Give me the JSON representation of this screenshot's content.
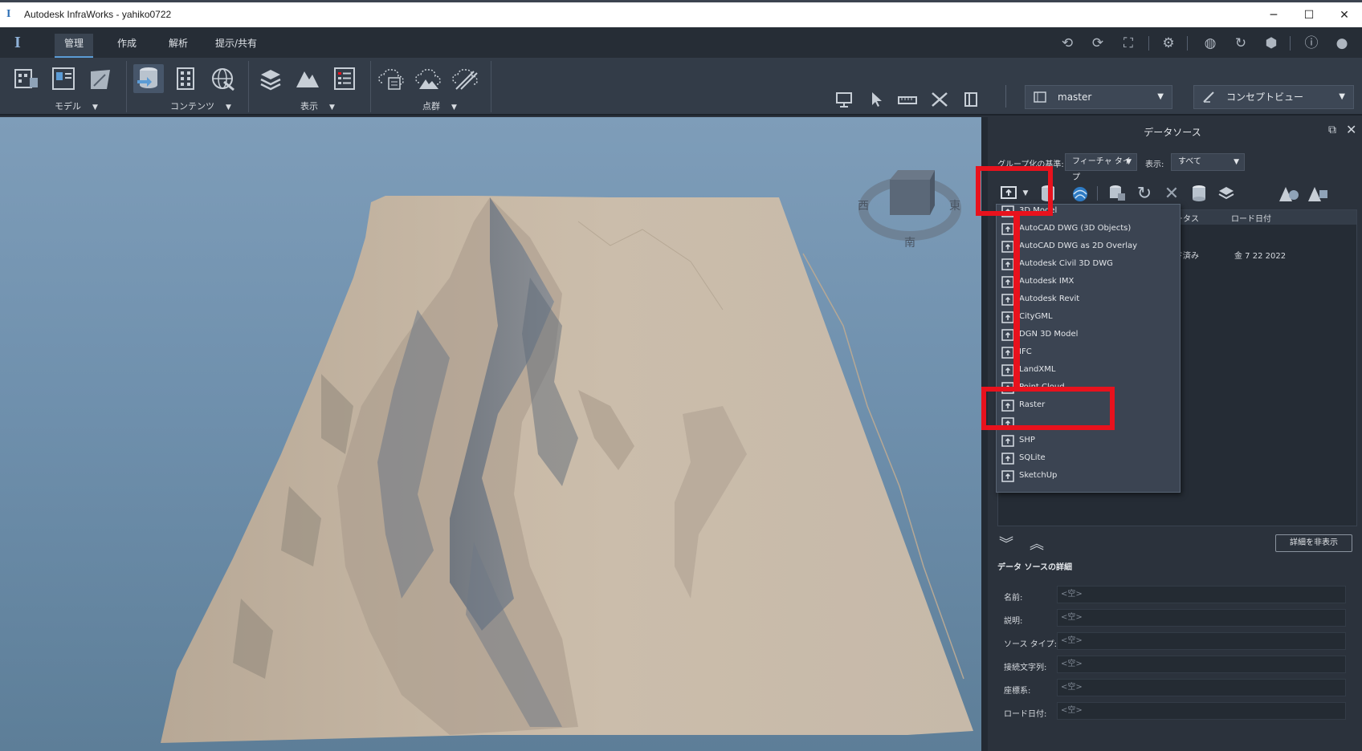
{
  "window": {
    "title": "Autodesk InfraWorks - yahiko0722",
    "controls": [
      "─",
      "☐",
      "✕"
    ]
  },
  "tabs": [
    {
      "label": "管理",
      "active": true
    },
    {
      "label": "作成",
      "active": false
    },
    {
      "label": "解析",
      "active": false
    },
    {
      "label": "提示/共有",
      "active": false
    }
  ],
  "top_icons": [
    "undo-icon",
    "redo-icon",
    "fullscreen-icon",
    "gear-icon",
    "globe-icon",
    "sync-icon",
    "cube-icon",
    "help-icon",
    "user-avatar-icon"
  ],
  "ribbon": {
    "groups": [
      {
        "label": "モデル"
      },
      {
        "label": "コンテンツ"
      },
      {
        "label": "表示"
      },
      {
        "label": "点群"
      }
    ],
    "model_combo": "master",
    "view_combo": "コンセプトビュー"
  },
  "viewcube": {
    "west": "西",
    "east": "東",
    "south": "南"
  },
  "panel": {
    "title": "データソース",
    "group_by_label": "グループ化の基準:",
    "group_by_value": "フィーチャ タイプ",
    "display_label": "表示:",
    "display_value": "すべて",
    "columns": {
      "status": "ステータス",
      "load_date": "ロード日付"
    },
    "row": {
      "status": "ロード済み",
      "load_date": "金 7 22 2022"
    },
    "hide_details": "詳細を非表示",
    "details_title": "データ ソースの詳細",
    "details": [
      {
        "label": "名前:",
        "value": "<空>"
      },
      {
        "label": "説明:",
        "value": "<空>"
      },
      {
        "label": "ソース タイプ:",
        "value": "<空>"
      },
      {
        "label": "接続文字列:",
        "value": "<空>"
      },
      {
        "label": "座標系:",
        "value": "<空>"
      },
      {
        "label": "ロード日付:",
        "value": "<空>"
      }
    ]
  },
  "dropdown": {
    "items": [
      "3D Model",
      "AutoCAD DWG (3D Objects)",
      "AutoCAD DWG as 2D Overlay",
      "Autodesk Civil 3D DWG",
      "Autodesk IMX",
      "Autodesk Revit",
      "CityGML",
      "DGN 3D Model",
      "IFC",
      "LandXML",
      "Point Cloud",
      "Raster",
      "",
      "SHP",
      "SQLite",
      "SketchUp"
    ]
  },
  "colors": {
    "highlight": "#e8121d",
    "accent": "#5b9bd5",
    "terrain": "#c9bba9"
  }
}
